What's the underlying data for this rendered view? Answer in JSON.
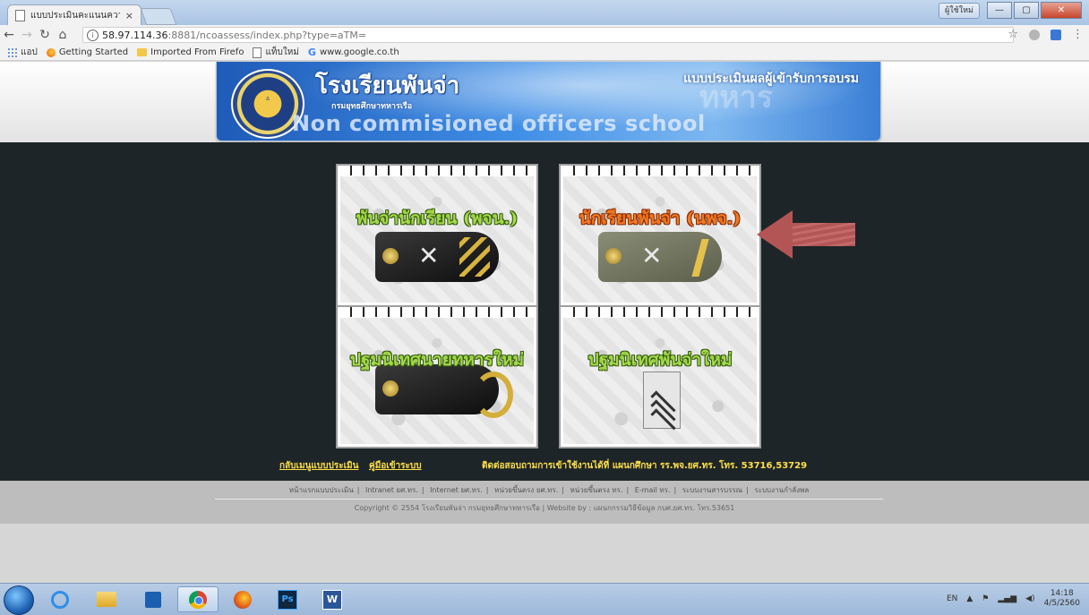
{
  "browser": {
    "tab_title": "แบบประเมินคะแนนความพ",
    "tab_close": "×",
    "user_button": "ผู้ใช้ใหม่",
    "url_host": "58.97.114.36",
    "url_path": ":8881/ncoassess/index.php?type=aTM=",
    "bookmarks": [
      "แอป",
      "Getting Started",
      "Imported From Firefo",
      "แท็บใหม่",
      "www.google.co.th"
    ]
  },
  "header": {
    "school_thai": "โรงเรียนพันจ่า",
    "dept_thai": "กรมยุทธศึกษาทหารเรือ",
    "school_english": "Non commisioned officers school",
    "eval_title": "แบบประเมินผลผู้เข้ารับการอบรม"
  },
  "cards": [
    {
      "label": "พันจ่านักเรียน (พจน.)"
    },
    {
      "label": "นักเรียนพันจ่า (นพจ.)"
    },
    {
      "label": "ปฐมนิเทศนายทหารใหม่"
    },
    {
      "label": "ปฐมนิเทศพันจ่าใหม่"
    }
  ],
  "links": {
    "back_menu": "กลับเมนูแบบประเมิน",
    "manual": "คู่มือเข้าระบบ",
    "contact": "ติดต่อสอบถามการเข้าใช้งานได้ที่ แผนกศึกษา รร.พจ.ยศ.ทร. โทร. 53716,53729"
  },
  "footer": {
    "nav": [
      "หน้าแรกแบบประเมิน",
      "Intranet ยศ.ทร.",
      "Internet ยศ.ทร.",
      "หน่วยขึ้นตรง ยศ.ทร.",
      "หน่วยขึ้นตรง ทร.",
      "E-mail ทร.",
      "ระบบงานสารบรรณ",
      "ระบบงานกำลังพล"
    ],
    "copyright": "Copyright © 2554 โรงเรียนพันจ่า กรมยุทธศึกษาทหารเรือ | Website by : แผนกกรรมวิธีข้อมูล กบศ.ยศ.ทร. โทร.53651"
  },
  "taskbar": {
    "lang": "EN",
    "time": "14:18",
    "date": "4/5/2560"
  }
}
